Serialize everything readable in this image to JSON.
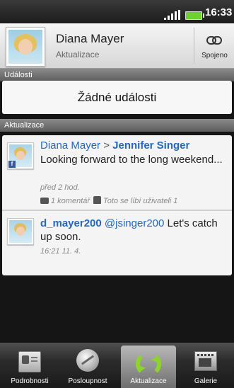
{
  "status_bar": {
    "time": "16:33"
  },
  "header": {
    "name": "Diana Mayer",
    "subtitle": "Aktualizace",
    "link_label": "Spojeno"
  },
  "events": {
    "heading": "Události",
    "empty_text": "Žádné události"
  },
  "updates": {
    "heading": "Aktualizace",
    "items": [
      {
        "author": "Diana Mayer",
        "arrow": ">",
        "target": "Jennifer Singer",
        "message": "Looking forward to the long weekend...",
        "time": "před 2 hod.",
        "comments": "1 komentář",
        "likes": "Toto se líbí uživateli 1"
      },
      {
        "author": "d_mayer200",
        "mention": "@jsinger200",
        "message": "Let's catch up soon.",
        "time": "16:21 11. 4."
      }
    ]
  },
  "tabs": [
    {
      "label": "Podrobnosti",
      "icon": "contact-card-icon"
    },
    {
      "label": "Posloupnost",
      "icon": "globe-icon"
    },
    {
      "label": "Aktualizace",
      "icon": "refresh-icon",
      "active": true
    },
    {
      "label": "Galerie",
      "icon": "gallery-icon"
    }
  ]
}
